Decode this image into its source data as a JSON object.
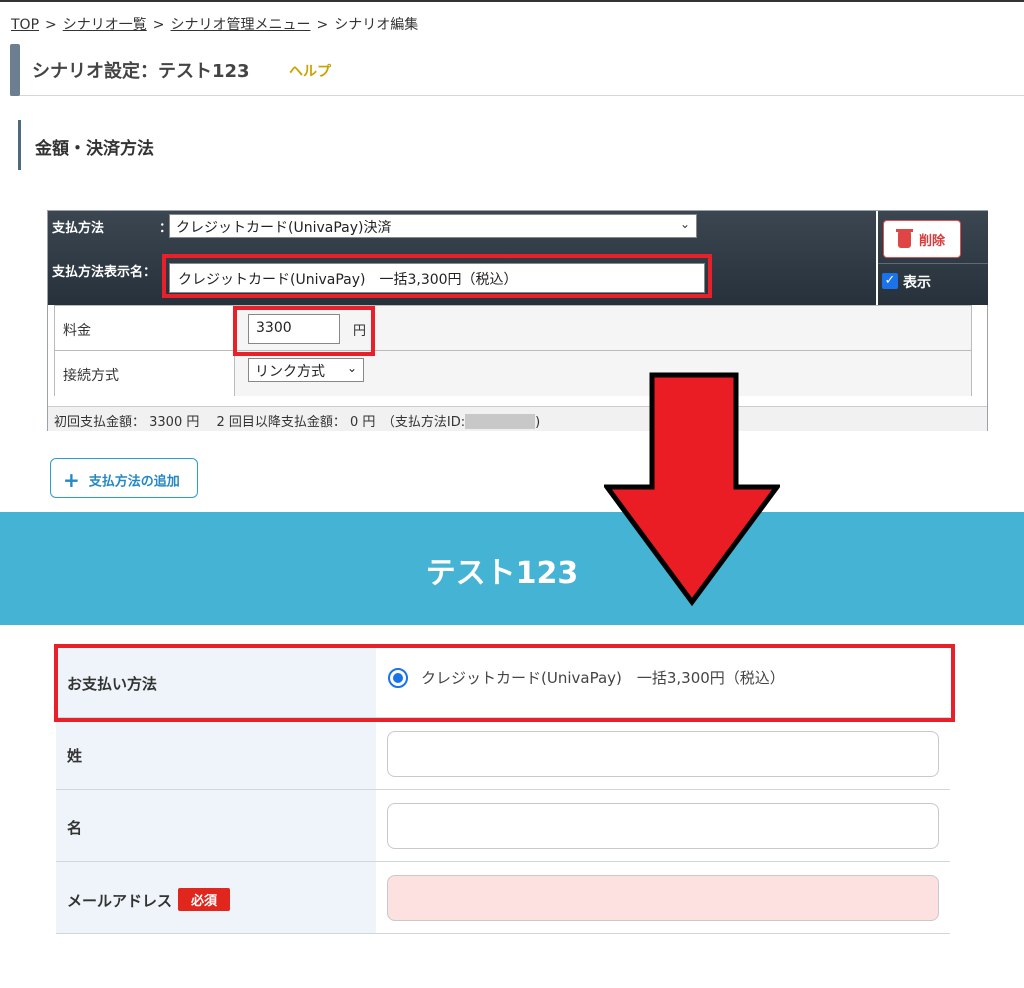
{
  "breadcrumb": {
    "items": [
      "TOP",
      "シナリオ一覧",
      "シナリオ管理メニュー"
    ],
    "current": "シナリオ編集",
    "separator": ">"
  },
  "page": {
    "title": "シナリオ設定：テスト123",
    "help_label": "ヘルプ"
  },
  "section": {
    "heading": "金額・決済方法"
  },
  "payment_panel": {
    "method_label": "支払方法",
    "method_colon": "：",
    "method_value": "クレジットカード(UnivaPay)決済",
    "display_name_label": "支払方法表示名：",
    "display_name_value": "クレジットカード(UnivaPay)　一括3,300円（税込）",
    "delete_label": "削除",
    "show_label": "表示",
    "show_checked": true,
    "rows": {
      "price_label": "料金",
      "price_value": "3300",
      "price_unit": "円",
      "connection_label": "接続方式",
      "connection_value": "リンク方式"
    },
    "summary_text": "初回支払金額： 3300 円　 2 回目以降支払金額： 0 円　（支払方法ID:",
    "summary_close": ")"
  },
  "add_button_label": "支払方法の追加",
  "preview": {
    "banner_title": "テスト123",
    "payment_label": "お支払い方法",
    "payment_option": "クレジットカード(UnivaPay)　一括3,300円（税込）",
    "last_name_label": "姓",
    "first_name_label": "名",
    "email_label": "メールアドレス",
    "required_badge": "必須"
  },
  "colors": {
    "banner": "#45b3d4",
    "highlight": "#e8202a",
    "arrow_fill": "#ea1c24",
    "panel_header": "#2f3a45"
  },
  "icons": [
    "trash-icon",
    "checkbox-checked-icon",
    "plus-icon",
    "chevron-down-icon",
    "radio-selected-icon",
    "down-arrow-icon"
  ]
}
